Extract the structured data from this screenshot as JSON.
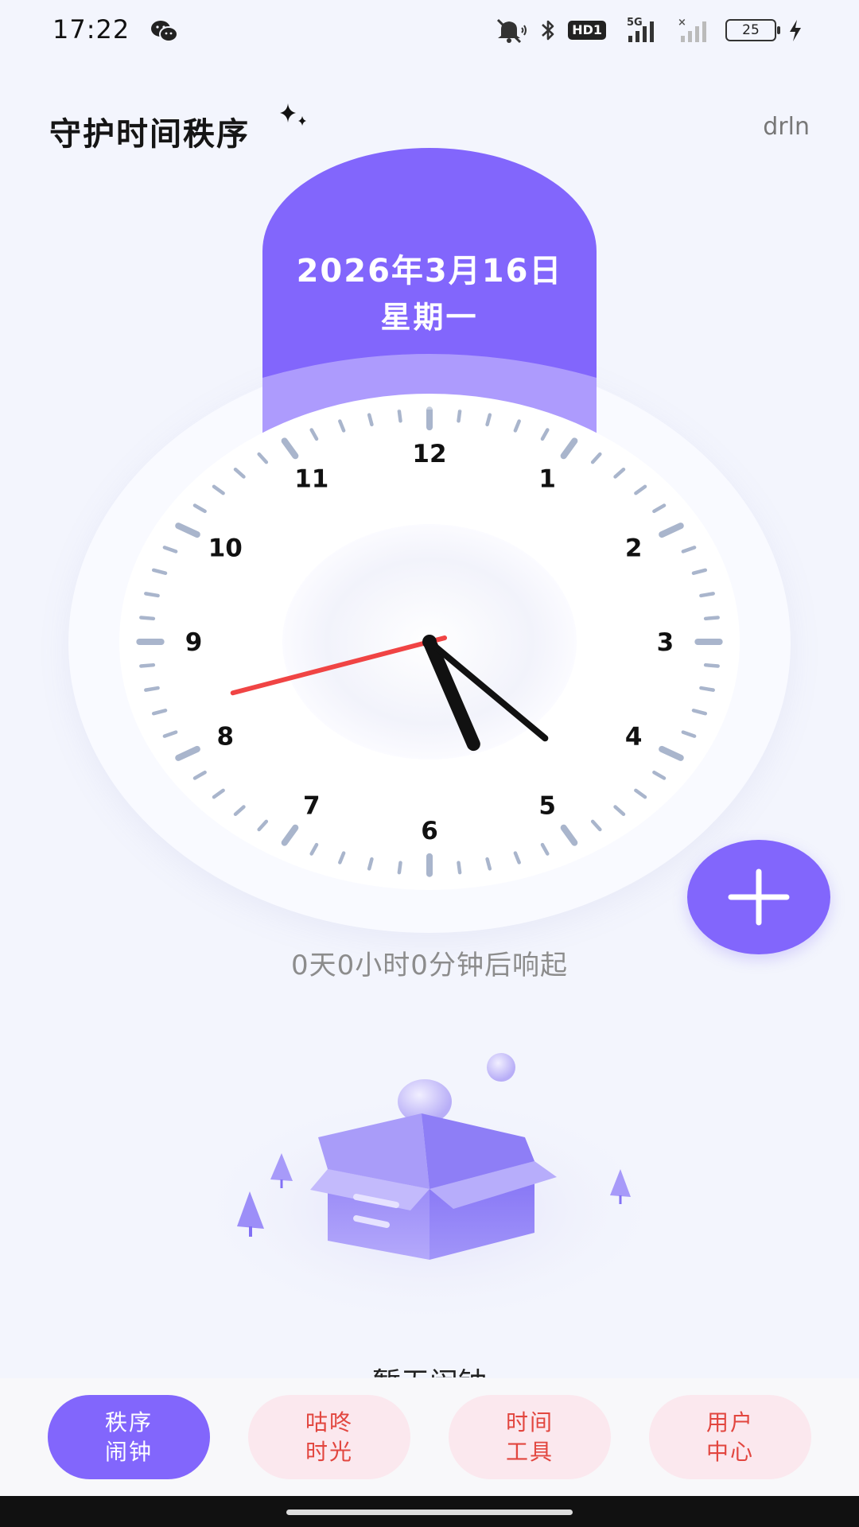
{
  "status_bar": {
    "time": "17:22",
    "hd_label": "HD1",
    "network_label": "5G",
    "battery_level": "25",
    "icons": [
      "wechat-icon",
      "mute-icon",
      "bluetooth-icon",
      "signal-icon",
      "charging-icon"
    ]
  },
  "header": {
    "title": "守护时间秩序",
    "user": "drln"
  },
  "clock": {
    "date": "2026年3月16日",
    "weekday": "星期一",
    "numbers": [
      "12",
      "1",
      "2",
      "3",
      "4",
      "5",
      "6",
      "7",
      "8",
      "9",
      "10",
      "11"
    ],
    "time_shown": {
      "hours": 5,
      "minutes": 22,
      "seconds": 42
    },
    "colors": {
      "accent": "#8266fc",
      "second_hand": "#f04444",
      "hands": "#111111",
      "ticks": "#a9b5cc"
    }
  },
  "countdown_text": "0天0小时0分钟后响起",
  "fab": {
    "icon": "plus-icon"
  },
  "empty_state": {
    "icon": "empty-box-icon",
    "text": "暂无闹钟"
  },
  "nav": {
    "items": [
      {
        "line1": "秩序",
        "line2": "闹钟",
        "active": true
      },
      {
        "line1": "咕咚",
        "line2": "时光",
        "active": false
      },
      {
        "line1": "时间",
        "line2": "工具",
        "active": false
      },
      {
        "line1": "用户",
        "line2": "中心",
        "active": false
      }
    ]
  }
}
